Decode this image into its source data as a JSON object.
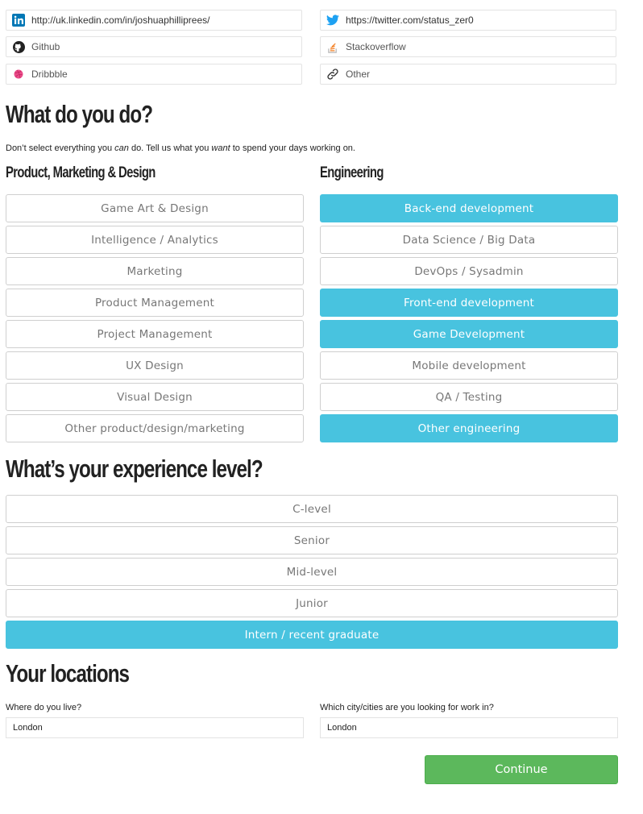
{
  "links": {
    "linkedin": {
      "value": "http://uk.linkedin.com/in/joshuaphilliprees/",
      "icon": "linkedin-icon"
    },
    "twitter": {
      "value": "https://twitter.com/status_zer0",
      "icon": "twitter-icon"
    },
    "github": {
      "value": "Github",
      "icon": "github-icon"
    },
    "stackoverflow": {
      "value": "Stackoverflow",
      "icon": "stackoverflow-icon"
    },
    "dribbble": {
      "value": "Dribbble",
      "icon": "dribbble-icon"
    },
    "other": {
      "value": "Other",
      "icon": "link-icon"
    }
  },
  "what_do_you_do": {
    "title": "What do you do?",
    "subtitle_pre": "Don’t select everything you ",
    "subtitle_can": "can",
    "subtitle_mid": " do. Tell us what you ",
    "subtitle_want": "want",
    "subtitle_post": " to spend your days working on.",
    "left_heading": "Product, Marketing & Design",
    "right_heading": "Engineering",
    "left_options": [
      {
        "label": "Game Art & Design",
        "selected": false
      },
      {
        "label": "Intelligence / Analytics",
        "selected": false
      },
      {
        "label": "Marketing",
        "selected": false
      },
      {
        "label": "Product Management",
        "selected": false
      },
      {
        "label": "Project Management",
        "selected": false
      },
      {
        "label": "UX Design",
        "selected": false
      },
      {
        "label": "Visual Design",
        "selected": false
      },
      {
        "label": "Other product/design/marketing",
        "selected": false
      }
    ],
    "right_options": [
      {
        "label": "Back-end development",
        "selected": true
      },
      {
        "label": "Data Science / Big Data",
        "selected": false
      },
      {
        "label": "DevOps / Sysadmin",
        "selected": false
      },
      {
        "label": "Front-end development",
        "selected": true
      },
      {
        "label": "Game Development",
        "selected": true
      },
      {
        "label": "Mobile development",
        "selected": false
      },
      {
        "label": "QA / Testing",
        "selected": false
      },
      {
        "label": "Other engineering",
        "selected": true
      }
    ]
  },
  "experience": {
    "title": "What’s your experience level?",
    "options": [
      {
        "label": "C-level",
        "selected": false
      },
      {
        "label": "Senior",
        "selected": false
      },
      {
        "label": "Mid-level",
        "selected": false
      },
      {
        "label": "Junior",
        "selected": false
      },
      {
        "label": "Intern / recent graduate",
        "selected": true
      }
    ]
  },
  "locations": {
    "title": "Your locations",
    "live_label": "Where do you live?",
    "live_value": "London",
    "work_label": "Which city/cities are you looking for work in?",
    "work_value": "London"
  },
  "continue_label": "Continue",
  "colors": {
    "selected": "#48c3df",
    "continue": "#5cb85c",
    "linkedin": "#0077b5",
    "twitter": "#1da1f2",
    "dribbble": "#ea4c89"
  }
}
